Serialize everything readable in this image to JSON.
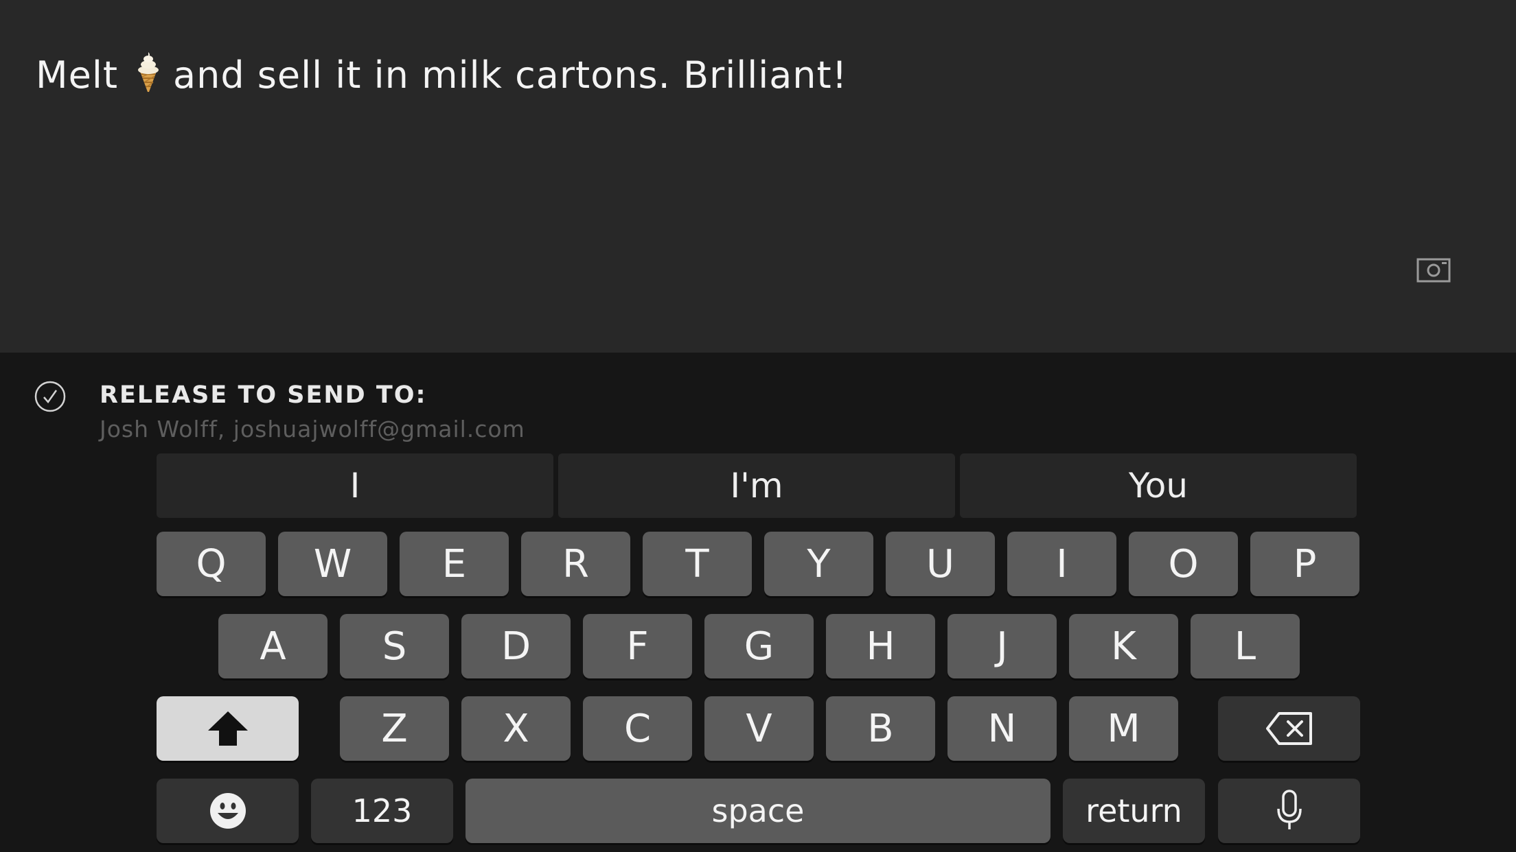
{
  "compose": {
    "message_prefix": "Melt",
    "message_emoji": "🍦",
    "message_suffix": "and sell it in milk cartons. Brilliant!",
    "camera_icon": "camera-icon"
  },
  "send_bar": {
    "check_icon": "checkmark-circle-icon",
    "title": "RELEASE TO SEND TO:",
    "recipient": "Josh Wolff, joshuajwolff@gmail.com"
  },
  "keyboard": {
    "suggestions": [
      "I",
      "I'm",
      "You"
    ],
    "row1": [
      "Q",
      "W",
      "E",
      "R",
      "T",
      "Y",
      "U",
      "I",
      "O",
      "P"
    ],
    "row2": [
      "A",
      "S",
      "D",
      "F",
      "G",
      "H",
      "J",
      "K",
      "L"
    ],
    "row3": [
      "Z",
      "X",
      "C",
      "V",
      "B",
      "N",
      "M"
    ],
    "shift_icon": "shift-arrow-icon",
    "delete_icon": "backspace-icon",
    "emoji_icon": "emoji-smiley-icon",
    "numbers_label": "123",
    "space_label": "space",
    "return_label": "return",
    "mic_icon": "microphone-icon"
  }
}
